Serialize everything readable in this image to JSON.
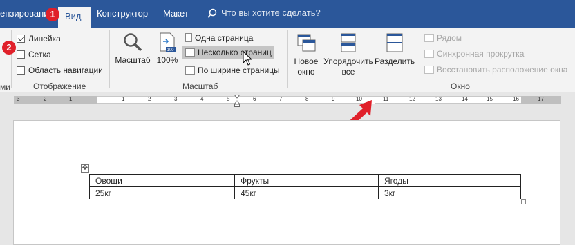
{
  "tabs": {
    "review": "ензирование",
    "view": "Вид",
    "design": "Конструктор",
    "layout": "Макет",
    "tell_me": "Что вы хотите сделать?"
  },
  "badges": {
    "step1": "1",
    "step2": "2"
  },
  "show_group": {
    "label": "Отображение",
    "ruler": {
      "label": "Линейка",
      "checked": true
    },
    "gridlines": {
      "label": "Сетка",
      "checked": false
    },
    "nav_pane": {
      "label": "Область навигации",
      "checked": false
    },
    "left_stub": "ми"
  },
  "zoom_group": {
    "label": "Масштаб",
    "zoom": "Масштаб",
    "hundred": "100%",
    "one_page": "Одна страница",
    "multiple_pages": "Несколько страниц",
    "page_width": "По ширине страницы"
  },
  "window_group": {
    "label": "Окно",
    "new_window": [
      "Новое",
      "окно"
    ],
    "arrange_all": [
      "Упорядочить",
      "все"
    ],
    "split": "Разделить",
    "side_by_side": "Рядом",
    "sync_scroll": "Синхронная прокрутка",
    "reset_position": "Восстановить расположение окна"
  },
  "ruler_numbers": [
    "3",
    "2",
    "1",
    "1",
    "2",
    "3",
    "4",
    "5",
    "6",
    "7",
    "8",
    "9",
    "10",
    "11",
    "12",
    "13",
    "14",
    "15",
    "16",
    "17"
  ],
  "table": {
    "rows": [
      [
        "Овощи",
        "Фрукты",
        "Ягоды"
      ],
      [
        "25кг",
        "45кг",
        "3кг"
      ]
    ]
  },
  "colors": {
    "accent": "#2b579a",
    "badge": "#e0202a",
    "arrow": "#e0202a"
  }
}
